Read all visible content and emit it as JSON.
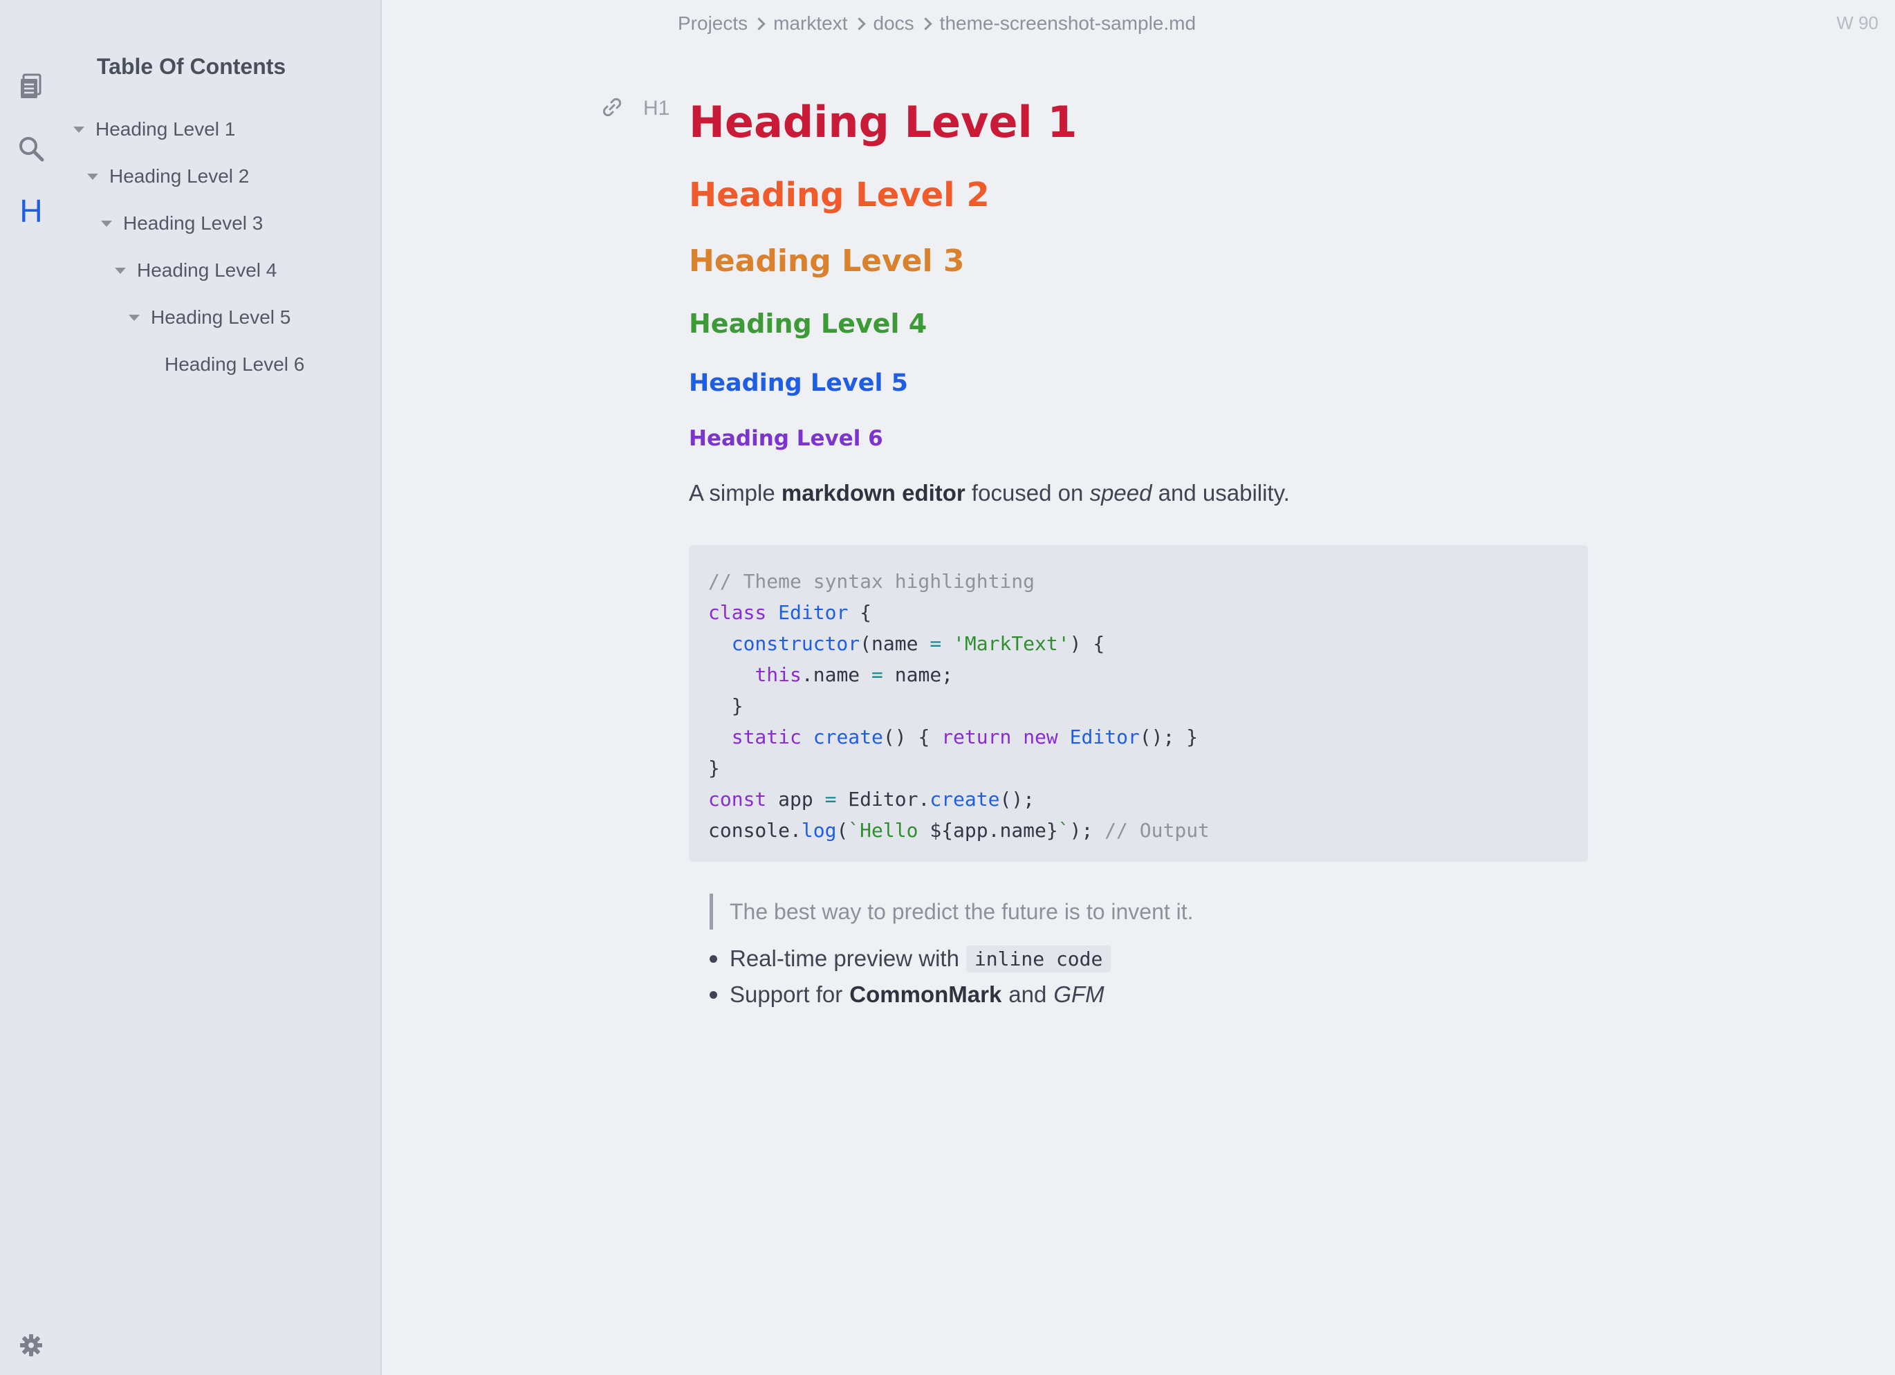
{
  "breadcrumb": {
    "items": [
      "Projects",
      "marktext",
      "docs",
      "theme-screenshot-sample.md"
    ]
  },
  "word_count": "W 90",
  "activity_bar": {
    "toc_label": "H",
    "icons": [
      "files-icon",
      "search-icon",
      "toc-icon",
      "settings-icon"
    ],
    "active_color": "#1f5ee3"
  },
  "sidebar": {
    "title": "Table Of Contents",
    "items": [
      {
        "label": "Heading Level 1"
      },
      {
        "label": "Heading Level 2"
      },
      {
        "label": "Heading Level 3"
      },
      {
        "label": "Heading Level 4"
      },
      {
        "label": "Heading Level 5"
      },
      {
        "label": "Heading Level 6"
      }
    ]
  },
  "editor": {
    "hover_tool_label": "H1",
    "headings": [
      {
        "text": "Heading Level 1",
        "color": "#c91b37"
      },
      {
        "text": "Heading Level 2",
        "color": "#ef5b2b"
      },
      {
        "text": "Heading Level 3",
        "color": "#d9812c"
      },
      {
        "text": "Heading Level 4",
        "color": "#3c9a37"
      },
      {
        "text": "Heading Level 5",
        "color": "#1f5ee3"
      },
      {
        "text": "Heading Level 6",
        "color": "#7b34cd"
      }
    ],
    "paragraph": {
      "p1": "A simple ",
      "bold": "markdown editor",
      "p2": " focused on ",
      "italic": "speed",
      "p3": " and usability."
    },
    "code": {
      "l1_comment": "// Theme syntax highlighting",
      "l2_kw": "class",
      "l2_name": "Editor",
      "l2_rest": " {",
      "l3_fn": "constructor",
      "l3_a": "(name ",
      "l3_op": "=",
      "l3_str": "'MarkText'",
      "l3_b": ") {",
      "l4_kw": "this",
      "l4_a": ".name ",
      "l4_op": "=",
      "l4_b": " name;",
      "l5": "}",
      "l6_kw": "static",
      "l6_fn": "create",
      "l6_a": "() { ",
      "l6_kw2": "return",
      "l6_kw3": "new",
      "l6_name": "Editor",
      "l6_b": "(); }",
      "l7": "}",
      "l8_kw": "const",
      "l8_a": " app ",
      "l8_op": "=",
      "l8_b": " Editor.",
      "l8_fn": "create",
      "l8_c": "();",
      "l9_a": "console.",
      "l9_fn": "log",
      "l9_b": "(",
      "l9_str": "`Hello ",
      "l9_c": "${app.name}",
      "l9_str2": "`",
      "l9_d": ");",
      "l9_comment": "// Output"
    },
    "quote": "The best way to predict the future is to invent it.",
    "list": {
      "item1_text": "Real-time preview with",
      "item1_code": "inline code",
      "item2_text": "Support for",
      "item2_bold": "CommonMark",
      "item2_mid": "and",
      "item2_italic": "GFM"
    }
  }
}
